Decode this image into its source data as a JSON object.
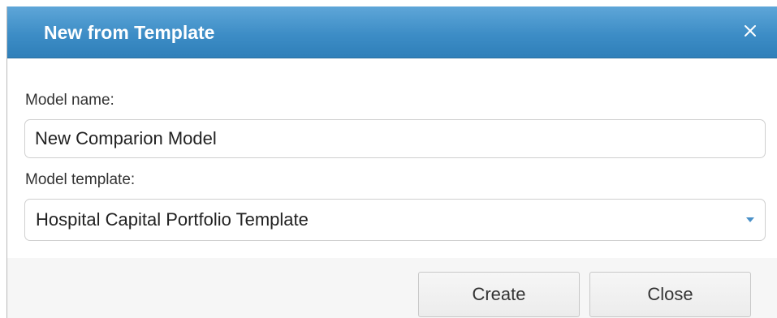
{
  "dialog": {
    "title": "New from Template",
    "close_icon": "close-icon"
  },
  "form": {
    "model_name_label": "Model name:",
    "model_name_value": "New Comparion Model",
    "model_template_label": "Model template:",
    "model_template_selected": "Hospital Capital Portfolio Template",
    "dropdown_icon": "caret-down-icon"
  },
  "footer": {
    "create_label": "Create",
    "close_label": "Close"
  },
  "colors": {
    "titlebar": "#3d8dc6",
    "title_text": "#ffffff",
    "footer_background": "#f6f6f6",
    "dropdown_caret": "#4a90c8"
  }
}
